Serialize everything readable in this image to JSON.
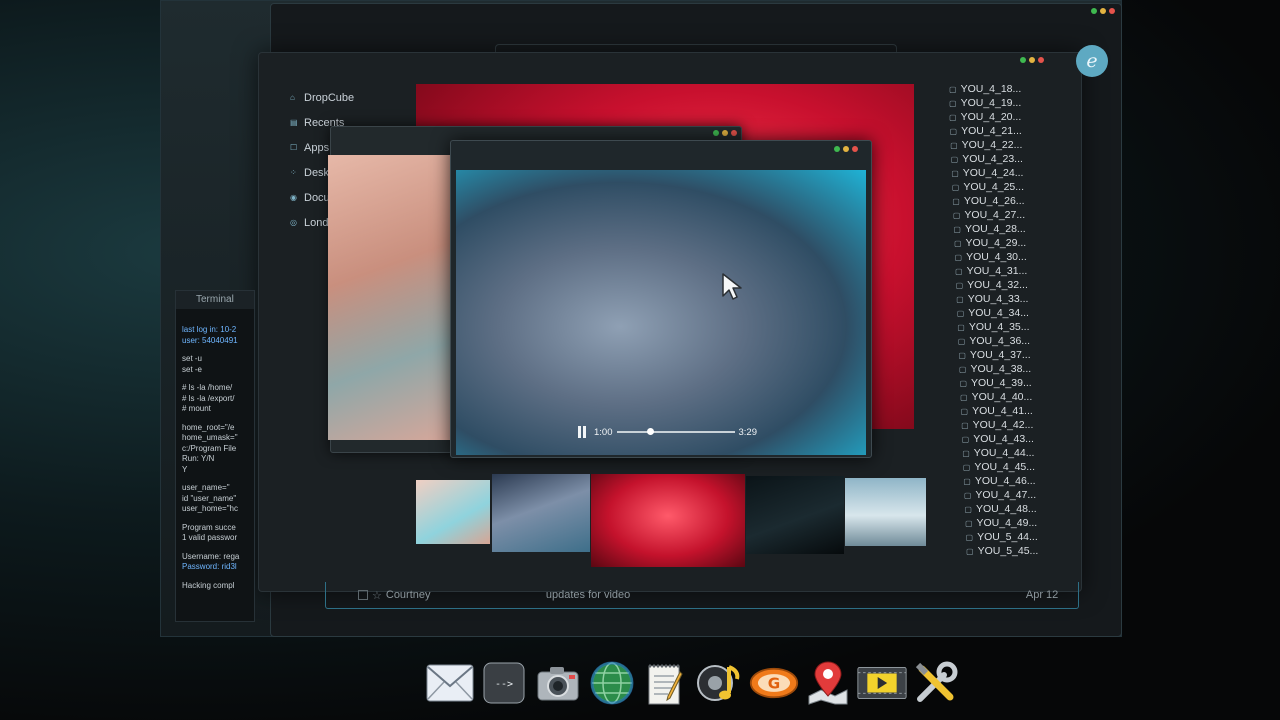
{
  "sidebar": {
    "items": [
      {
        "label": "DropCube",
        "icon": "dropcube-icon"
      },
      {
        "label": "Recents",
        "icon": "recents-icon"
      },
      {
        "label": "Apps",
        "icon": "apps-icon"
      },
      {
        "label": "Deskt",
        "icon": "desktop-icon"
      },
      {
        "label": "Docu",
        "icon": "documents-icon"
      },
      {
        "label": "Londo",
        "icon": "location-icon"
      }
    ]
  },
  "files": [
    "YOU_4_18...",
    "YOU_4_19...",
    "YOU_4_20...",
    "YOU_4_21...",
    "YOU_4_22...",
    "YOU_4_23...",
    "YOU_4_24...",
    "YOU_4_25...",
    "YOU_4_26...",
    "YOU_4_27...",
    "YOU_4_28...",
    "YOU_4_29...",
    "YOU_4_30...",
    "YOU_4_31...",
    "YOU_4_32...",
    "YOU_4_33...",
    "YOU_4_34...",
    "YOU_4_35...",
    "YOU_4_36...",
    "YOU_4_37...",
    "YOU_4_38...",
    "YOU_4_39...",
    "YOU_4_40...",
    "YOU_4_41...",
    "YOU_4_42...",
    "YOU_4_43...",
    "YOU_4_44...",
    "YOU_4_45...",
    "YOU_4_46...",
    "YOU_4_47...",
    "YOU_4_48...",
    "YOU_4_49...",
    "YOU_5_44...",
    "YOU_5_45..."
  ],
  "terminal": {
    "title": "Terminal",
    "blocks": [
      [
        "last log in: 10-2",
        "user: 54040491"
      ],
      [
        "set -u",
        "set -e"
      ],
      [
        "# ls -la /home/",
        "# ls -la /export/",
        "# mount"
      ],
      [
        "home_root=\"/e",
        "home_umask=\"",
        "c:/Program File",
        "Run: Y/N",
        "Y"
      ],
      [
        "user_name=\"",
        "id \"user_name\"",
        "user_home=\"hc"
      ],
      [
        "Program succe",
        "1 valid passwor"
      ],
      [
        "Username: rega",
        "Password: rid3l"
      ],
      [
        "Hacking compl"
      ]
    ]
  },
  "player": {
    "current_time": "1:00",
    "duration": "3:29",
    "progress": 0.287
  },
  "mail_row": {
    "sender": "Courtney",
    "subject": "updates for video",
    "date": "Apr 12"
  },
  "avatar_letter": "e",
  "dock": [
    {
      "name": "mail-icon"
    },
    {
      "name": "terminal-icon",
      "label": "-->"
    },
    {
      "name": "camera-icon"
    },
    {
      "name": "globe-icon"
    },
    {
      "name": "notes-icon"
    },
    {
      "name": "music-icon"
    },
    {
      "name": "g-app-icon",
      "label": "G"
    },
    {
      "name": "map-pin-icon"
    },
    {
      "name": "video-player-icon"
    },
    {
      "name": "tools-icon"
    }
  ],
  "colors": {
    "accent": "#5ea9c2",
    "hero_red": "#d0142f",
    "video_cyan": "#1fb3d6"
  }
}
